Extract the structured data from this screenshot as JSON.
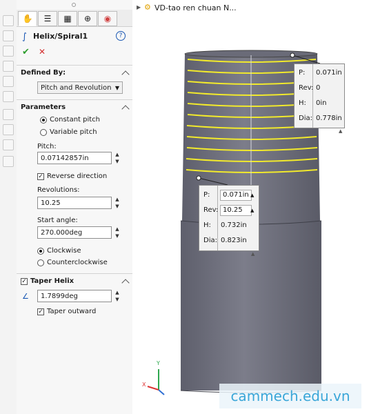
{
  "colors": {
    "accent_yellow": "#f2ea2b",
    "body_gray": "#71727f",
    "ok_green": "#2f9e2f",
    "cancel_red": "#d32f2f",
    "watermark_blue": "#3aa6d8"
  },
  "breadcrumb": {
    "title": "VD-tao ren chuan N..."
  },
  "feature": {
    "title": "Helix/Spiral1",
    "help": "?",
    "ok": "✔",
    "cancel": "✕"
  },
  "defined_by": {
    "heading": "Defined By:",
    "selected": "Pitch and Revolution"
  },
  "parameters": {
    "heading": "Parameters",
    "constant_pitch": "Constant pitch",
    "variable_pitch": "Variable pitch",
    "pitch_label": "Pitch:",
    "pitch_value": "0.07142857in",
    "reverse_direction": "Reverse direction",
    "revolutions_label": "Revolutions:",
    "revolutions_value": "10.25",
    "start_angle_label": "Start angle:",
    "start_angle_value": "270.000deg",
    "clockwise": "Clockwise",
    "counterclockwise": "Counterclockwise"
  },
  "taper": {
    "heading": "Taper Helix",
    "angle_value": "1.7899deg",
    "taper_outward": "Taper outward"
  },
  "callout_top": {
    "p_label": "P:",
    "p_value": "0.071in",
    "rev_label": "Rev:",
    "rev_value": "0",
    "h_label": "H:",
    "h_value": "0in",
    "dia_label": "Dia:",
    "dia_value": "0.778in"
  },
  "callout_mid": {
    "p_label": "P:",
    "p_value": "0.071in",
    "rev_label": "Rev:",
    "rev_value": "10.25",
    "h_label": "H:",
    "h_value": "0.732in",
    "dia_label": "Dia:",
    "dia_value": "0.823in"
  },
  "triad": {
    "x": "X",
    "y": "Y"
  },
  "watermark": "cammech.edu.vn"
}
